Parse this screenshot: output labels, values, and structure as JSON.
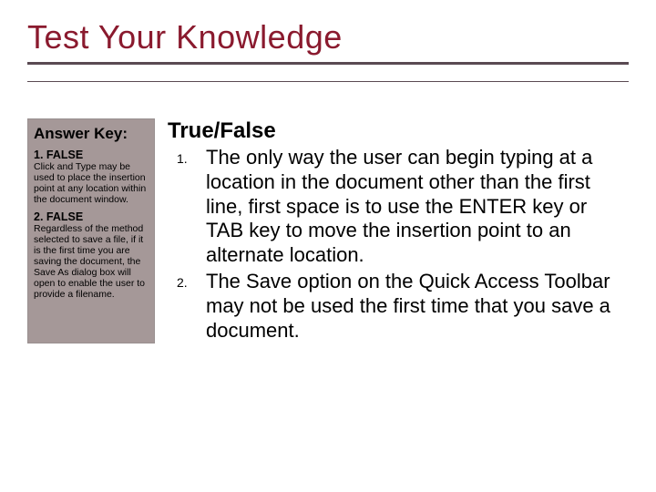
{
  "title": "Test Your Knowledge",
  "sidebar": {
    "heading": "Answer Key:",
    "answers": [
      {
        "label": "1. FALSE",
        "explanation": "Click and Type may be used to place the insertion point at any location within the document window."
      },
      {
        "label": "2. FALSE",
        "explanation": "Regardless of the method selected to save a file, if it is the first time you are saving the document, the Save As dialog box will open to enable the user to provide a filename."
      }
    ]
  },
  "main": {
    "heading": "True/False",
    "questions": [
      {
        "num": "1.",
        "text": "The only way the user can begin typing at a location in the document other than the first line, first space is to use the ENTER key or TAB key to move the insertion point to an alternate location."
      },
      {
        "num": "2.",
        "text": "The Save option on the Quick Access Toolbar may not be used the first time that you save a document."
      }
    ]
  }
}
